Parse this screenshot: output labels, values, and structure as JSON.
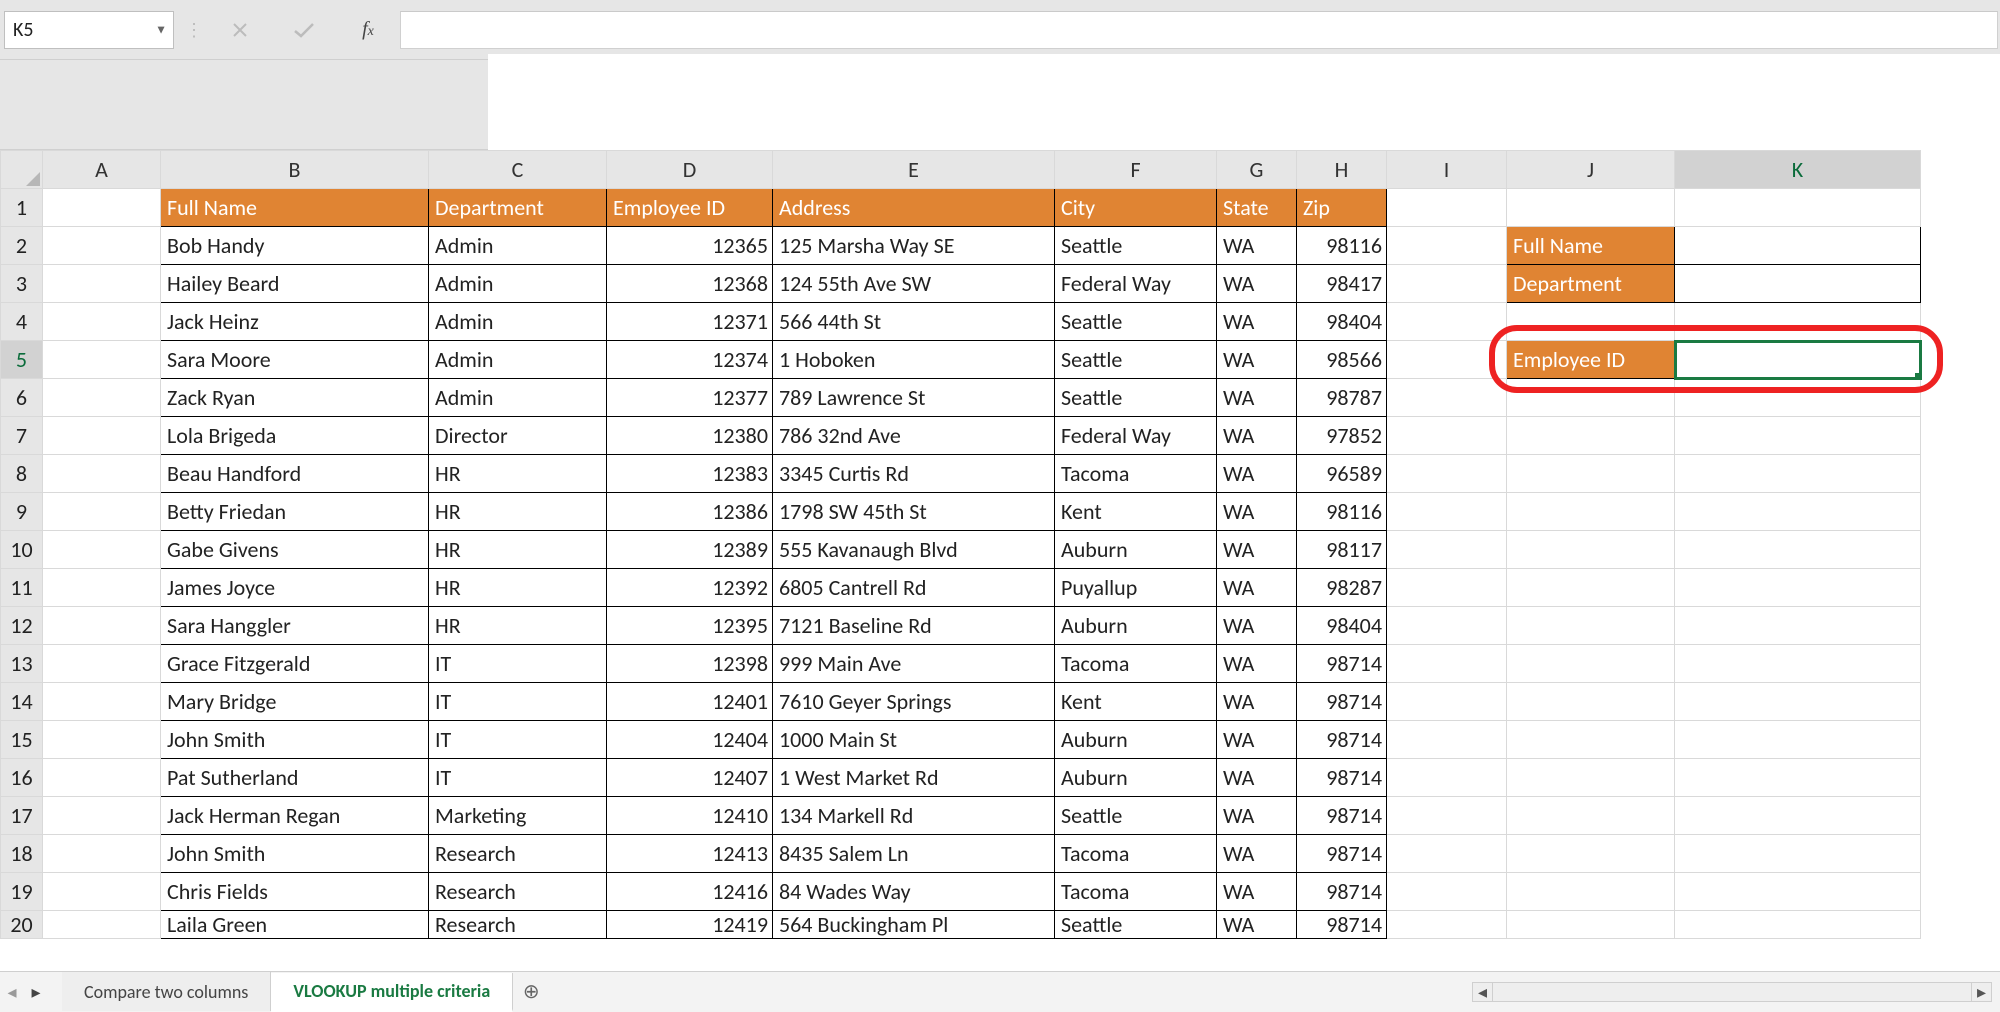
{
  "namebox": "K5",
  "formula_bar_value": "",
  "columns": [
    "A",
    "B",
    "C",
    "D",
    "E",
    "F",
    "G",
    "H",
    "I",
    "J",
    "K"
  ],
  "col_widths": {
    "rowhdr": 42,
    "A": 118,
    "B": 268,
    "C": 178,
    "D": 166,
    "E": 282,
    "F": 162,
    "G": 80,
    "H": 90,
    "I": 120,
    "J": 168,
    "K": 246
  },
  "active_cell": {
    "col": "K",
    "row": 5
  },
  "table_headers": [
    "Full Name",
    "Department",
    "Employee ID",
    "Address",
    "City",
    "State",
    "Zip"
  ],
  "rows": [
    {
      "n": 1
    },
    {
      "n": 2,
      "d": [
        "Bob Handy",
        "Admin",
        "12365",
        "125 Marsha Way SE",
        "Seattle",
        "WA",
        "98116"
      ]
    },
    {
      "n": 3,
      "d": [
        "Hailey Beard",
        "Admin",
        "12368",
        "124 55th Ave SW",
        "Federal Way",
        "WA",
        "98417"
      ]
    },
    {
      "n": 4,
      "d": [
        "Jack Heinz",
        "Admin",
        "12371",
        "566 44th St",
        "Seattle",
        "WA",
        "98404"
      ]
    },
    {
      "n": 5,
      "d": [
        "Sara Moore",
        "Admin",
        "12374",
        "1 Hoboken",
        "Seattle",
        "WA",
        "98566"
      ]
    },
    {
      "n": 6,
      "d": [
        "Zack Ryan",
        "Admin",
        "12377",
        "789 Lawrence St",
        "Seattle",
        "WA",
        "98787"
      ]
    },
    {
      "n": 7,
      "d": [
        "Lola Brigeda",
        "Director",
        "12380",
        "786 32nd Ave",
        "Federal Way",
        "WA",
        "97852"
      ]
    },
    {
      "n": 8,
      "d": [
        "Beau Handford",
        "HR",
        "12383",
        "3345 Curtis Rd",
        "Tacoma",
        "WA",
        "96589"
      ]
    },
    {
      "n": 9,
      "d": [
        "Betty Friedan",
        "HR",
        "12386",
        "1798 SW 45th St",
        "Kent",
        "WA",
        "98116"
      ]
    },
    {
      "n": 10,
      "d": [
        "Gabe Givens",
        "HR",
        "12389",
        "555 Kavanaugh Blvd",
        "Auburn",
        "WA",
        "98117"
      ]
    },
    {
      "n": 11,
      "d": [
        "James Joyce",
        "HR",
        "12392",
        "6805 Cantrell Rd",
        "Puyallup",
        "WA",
        "98287"
      ]
    },
    {
      "n": 12,
      "d": [
        "Sara Hanggler",
        "HR",
        "12395",
        "7121 Baseline Rd",
        "Auburn",
        "WA",
        "98404"
      ]
    },
    {
      "n": 13,
      "d": [
        "Grace Fitzgerald",
        "IT",
        "12398",
        "999 Main Ave",
        "Tacoma",
        "WA",
        "98714"
      ]
    },
    {
      "n": 14,
      "d": [
        "Mary Bridge",
        "IT",
        "12401",
        "7610 Geyer Springs",
        "Kent",
        "WA",
        "98714"
      ]
    },
    {
      "n": 15,
      "d": [
        "John Smith",
        "IT",
        "12404",
        "1000 Main St",
        "Auburn",
        "WA",
        "98714"
      ]
    },
    {
      "n": 16,
      "d": [
        "Pat Sutherland",
        "IT",
        "12407",
        "1 West Market Rd",
        "Auburn",
        "WA",
        "98714"
      ]
    },
    {
      "n": 17,
      "d": [
        "Jack Herman Regan",
        "Marketing",
        "12410",
        "134 Markell Rd",
        "Seattle",
        "WA",
        "98714"
      ]
    },
    {
      "n": 18,
      "d": [
        "John Smith",
        "Research",
        "12413",
        "8435 Salem Ln",
        "Tacoma",
        "WA",
        "98714"
      ]
    },
    {
      "n": 19,
      "d": [
        "Chris Fields",
        "Research",
        "12416",
        "84 Wades Way",
        "Tacoma",
        "WA",
        "98714"
      ]
    },
    {
      "n": 20,
      "d": [
        "Laila Green",
        "Research",
        "12419",
        "564 Buckingham Pl",
        "Seattle",
        "WA",
        "98714"
      ]
    }
  ],
  "lookup": {
    "full_name_label": "Full Name",
    "department_label": "Department",
    "employee_id_label": "Employee ID",
    "full_name_value": "",
    "department_value": "",
    "employee_id_value": ""
  },
  "tabs": {
    "inactive": "Compare two columns",
    "active": "VLOOKUP multiple criteria"
  }
}
